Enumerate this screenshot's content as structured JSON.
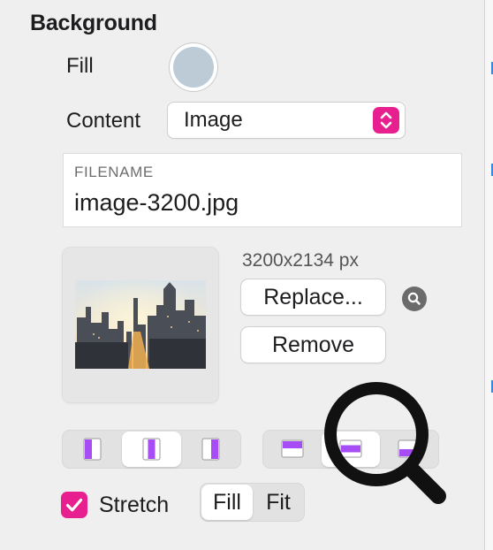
{
  "section": {
    "title": "Background"
  },
  "fill": {
    "label": "Fill",
    "color": "#bccbd6"
  },
  "content": {
    "label": "Content",
    "value": "Image",
    "accent": "#e8208f"
  },
  "filename": {
    "caption": "FILENAME",
    "value": "image-3200.jpg"
  },
  "image": {
    "dimensions": "3200x2134 px",
    "replace_label": "Replace...",
    "remove_label": "Remove",
    "preview": "city-skyline-thumbnail"
  },
  "alignment": {
    "horizontal": {
      "options": [
        "align-left-icon",
        "align-center-icon",
        "align-right-icon"
      ],
      "selected": 1
    },
    "vertical": {
      "options": [
        "align-top-icon",
        "align-middle-icon",
        "align-bottom-icon"
      ],
      "selected": 1
    },
    "icon_color": "#a64df5"
  },
  "stretch": {
    "label": "Stretch",
    "checked": true
  },
  "scale_mode": {
    "options": [
      "Fill",
      "Fit"
    ],
    "selected": "Fill"
  }
}
